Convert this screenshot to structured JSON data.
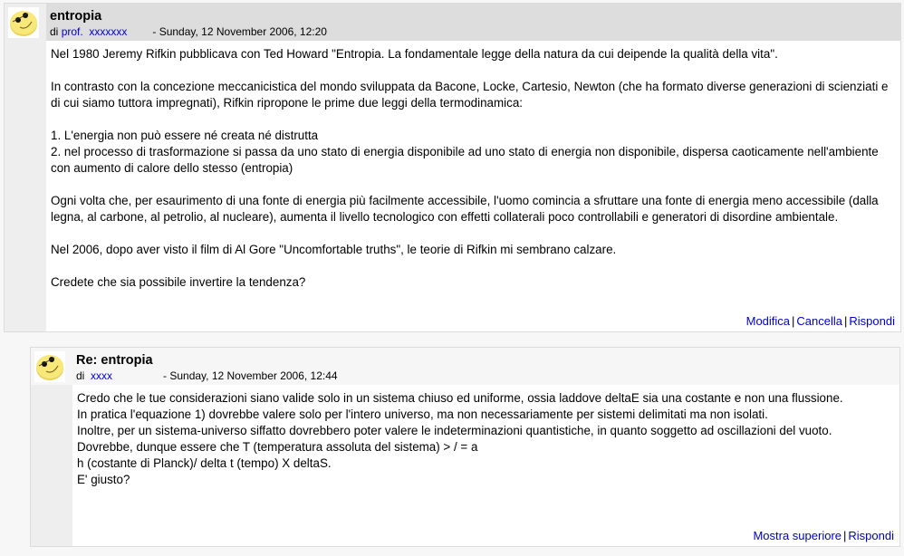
{
  "posts": [
    {
      "subject": "entropia",
      "by_prefix": "di",
      "author": "prof.  xxxxxxx",
      "date": "- Sunday, 12 November 2006, 12:20",
      "avatar_icon": "smiley-face-icon",
      "paragraphs": [
        "Nel 1980 Jeremy Rifkin pubblicava con Ted Howard \"Entropia. La fondamentale legge della natura da cui deipende la qualità della vita\".",
        "In contrasto con la concezione meccanicistica del mondo sviluppata da Bacone, Locke, Cartesio, Newton (che ha formato diverse generazioni di scienziati e di cui siamo tuttora impregnati), Rifkin ripropone le prime due leggi della termodinamica:",
        "1. L'energia non può essere né creata né distrutta\n2. nel processo di trasformazione si passa da uno stato di energia disponibile ad uno stato di energia non disponibile, dispersa caoticamente nell'ambiente con aumento di calore dello stesso (entropia)",
        "Ogni volta che, per esaurimento di una fonte di energia più facilmente accessibile, l'uomo comincia a sfruttare una fonte di energia meno accessibile (dalla legna, al carbone, al petrolio, al nucleare), aumenta il livello tecnologico con effetti collaterali poco controllabili e generatori di disordine ambientale.",
        "Nel 2006, dopo aver visto il film di Al Gore \"Uncomfortable truths\", le teorie di Rifkin mi sembrano calzare.",
        "Credete che sia possibile invertire la tendenza?"
      ],
      "commands": [
        "Modifica",
        "Cancella",
        "Rispondi"
      ],
      "separator": "|"
    },
    {
      "subject": "Re: entropia",
      "by_prefix": "di",
      "author": "xxxx",
      "date": "- Sunday, 12 November 2006, 12:44",
      "avatar_icon": "smiley-face-icon",
      "lines": [
        "Credo che le tue considerazioni siano valide solo in un sistema chiuso ed uniforme, ossia laddove deltaE sia una costante e non una flussione.",
        "In pratica l'equazione 1) dovrebbe valere solo per l'intero universo, ma non necessariamente per sistemi delimitati ma non isolati.",
        "Inoltre, per un sistema-universo siffatto dovrebbero poter valere le indeterminazioni quantistiche, in quanto soggetto ad oscillazioni del vuoto.",
        "Dovrebbe, dunque essere che T (temperatura assoluta del sistema) > / = a",
        "h (costante di Planck)/ delta t (tempo) X deltaS.",
        "E' giusto?"
      ],
      "commands": [
        "Mostra superiore",
        "Rispondi"
      ],
      "separator": "|"
    }
  ]
}
